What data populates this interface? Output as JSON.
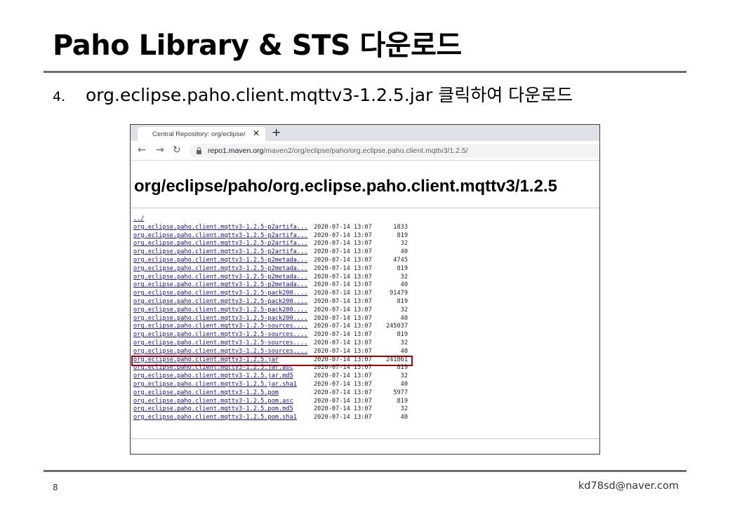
{
  "slide": {
    "title": "Paho Library & STS 다운로드",
    "step_number": "4.",
    "step_text": "org.eclipse.paho.client.mqttv3-1.2.5.jar 클릭하여 다운로드",
    "page_number": "8",
    "email": "kd78sd@naver.com"
  },
  "browser": {
    "tab_title": "Central Repository: org/eclipse/",
    "tab_close": "✕",
    "new_tab": "+",
    "back": "←",
    "forward": "→",
    "reload": "↻",
    "url_host": "repo1.maven.org",
    "url_path": "/maven2/org/eclipse/paho/org.eclipse.paho.client.mqttv3/1.2.5/",
    "icons": [
      "back-arrow-icon",
      "forward-arrow-icon",
      "reload-icon",
      "lock-icon",
      "close-icon",
      "plus-icon"
    ]
  },
  "page": {
    "heading": "org/eclipse/paho/org.eclipse.paho.client.mqttv3/1.2.5",
    "parent_link": "../",
    "highlighted_file": "org.eclipse.paho.client.mqttv3-1.2.5.jar",
    "highlight_color": "#b00000",
    "link_color": "#1a0dab",
    "files": [
      {
        "name": "org.eclipse.paho.client.mqttv3-1.2.5-p2artifa...",
        "date": "2020-07-14 13:07",
        "size": "1833"
      },
      {
        "name": "org.eclipse.paho.client.mqttv3-1.2.5-p2artifa...",
        "date": "2020-07-14 13:07",
        "size": "819"
      },
      {
        "name": "org.eclipse.paho.client.mqttv3-1.2.5-p2artifa...",
        "date": "2020-07-14 13:07",
        "size": "32"
      },
      {
        "name": "org.eclipse.paho.client.mqttv3-1.2.5-p2artifa...",
        "date": "2020-07-14 13:07",
        "size": "40"
      },
      {
        "name": "org.eclipse.paho.client.mqttv3-1.2.5-p2metada...",
        "date": "2020-07-14 13:07",
        "size": "4745"
      },
      {
        "name": "org.eclipse.paho.client.mqttv3-1.2.5-p2metada...",
        "date": "2020-07-14 13:07",
        "size": "819"
      },
      {
        "name": "org.eclipse.paho.client.mqttv3-1.2.5-p2metada...",
        "date": "2020-07-14 13:07",
        "size": "32"
      },
      {
        "name": "org.eclipse.paho.client.mqttv3-1.2.5-p2metada...",
        "date": "2020-07-14 13:07",
        "size": "40"
      },
      {
        "name": "org.eclipse.paho.client.mqttv3-1.2.5-pack200....",
        "date": "2020-07-14 13:07",
        "size": "91479"
      },
      {
        "name": "org.eclipse.paho.client.mqttv3-1.2.5-pack200....",
        "date": "2020-07-14 13:07",
        "size": "819"
      },
      {
        "name": "org.eclipse.paho.client.mqttv3-1.2.5-pack200....",
        "date": "2020-07-14 13:07",
        "size": "32"
      },
      {
        "name": "org.eclipse.paho.client.mqttv3-1.2.5-pack200....",
        "date": "2020-07-14 13:07",
        "size": "40"
      },
      {
        "name": "org.eclipse.paho.client.mqttv3-1.2.5-sources....",
        "date": "2020-07-14 13:07",
        "size": "245037"
      },
      {
        "name": "org.eclipse.paho.client.mqttv3-1.2.5-sources....",
        "date": "2020-07-14 13:07",
        "size": "819"
      },
      {
        "name": "org.eclipse.paho.client.mqttv3-1.2.5-sources....",
        "date": "2020-07-14 13:07",
        "size": "32"
      },
      {
        "name": "org.eclipse.paho.client.mqttv3-1.2.5-sources....",
        "date": "2020-07-14 13:07",
        "size": "40"
      },
      {
        "name": "org.eclipse.paho.client.mqttv3-1.2.5.jar",
        "date": "2020-07-14 13:07",
        "size": "241861"
      },
      {
        "name": "org.eclipse.paho.client.mqttv3-1.2.5.jar.asc",
        "date": "2020-07-14 13:07",
        "size": "819"
      },
      {
        "name": "org.eclipse.paho.client.mqttv3-1.2.5.jar.md5",
        "date": "2020-07-14 13:07",
        "size": "32"
      },
      {
        "name": "org.eclipse.paho.client.mqttv3-1.2.5.jar.sha1",
        "date": "2020-07-14 13:07",
        "size": "40"
      },
      {
        "name": "org.eclipse.paho.client.mqttv3-1.2.5.pom",
        "date": "2020-07-14 13:07",
        "size": "5977"
      },
      {
        "name": "org.eclipse.paho.client.mqttv3-1.2.5.pom.asc",
        "date": "2020-07-14 13:07",
        "size": "819"
      },
      {
        "name": "org.eclipse.paho.client.mqttv3-1.2.5.pom.md5",
        "date": "2020-07-14 13:07",
        "size": "32"
      },
      {
        "name": "org.eclipse.paho.client.mqttv3-1.2.5.pom.sha1",
        "date": "2020-07-14 13:07",
        "size": "40"
      }
    ]
  }
}
